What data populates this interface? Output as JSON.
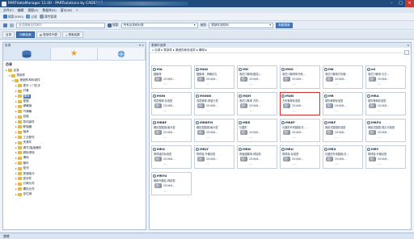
{
  "window": {
    "title": "PARTdataManager 11.00 - PARTsolutions by CADENAS",
    "min": "–",
    "max": "□",
    "close": "×"
  },
  "menu": [
    "文件(F)",
    "编辑",
    "视图(V)",
    "数据库(D)",
    "窗口(W)",
    "?"
  ],
  "toolbar1": {
    "items": [
      {
        "icon": "search-icon",
        "label": "搜索(SMO)",
        "color": "#3f74b7"
      },
      {
        "icon": "filter-icon",
        "label": "过滤",
        "color": "#6b8fc2"
      },
      {
        "icon": "properties-icon",
        "label": "属性管理",
        "color": "#7c98bd"
      }
    ]
  },
  "toolbar2": {
    "search_placeholder": "全文搜索文件夹中",
    "search_button": "搜索",
    "scope_value": "所有目录和分类",
    "mode_value": "按照",
    "unit_value": "零部件或机构",
    "accent_button": "新建搜索"
  },
  "tabs": [
    {
      "label": "目录",
      "active": false
    },
    {
      "label": "对照检索",
      "active": true
    },
    {
      "label": "零部件列表",
      "active": false
    },
    {
      "label": "搜索结果",
      "active": false
    }
  ],
  "left_panel": {
    "header": "目录",
    "tree_title": "目录",
    "tree": [
      {
        "indent": 0,
        "toggle": "▸",
        "label": "目录",
        "color": "#e2b84a",
        "selected": false
      },
      {
        "indent": 1,
        "toggle": "▾",
        "label": "零部件",
        "color": "#e2b84a",
        "selected": false
      },
      {
        "indent": 2,
        "toggle": "▾",
        "label": "紧固件和标准件",
        "color": "#e2b84a",
        "selected": false
      },
      {
        "indent": 3,
        "toggle": "▸",
        "label": "把手 / 门拉手",
        "color": "#e2b84a",
        "selected": false
      },
      {
        "indent": 3,
        "toggle": "▸",
        "label": "衬套",
        "color": "#e2b84a",
        "selected": false
      },
      {
        "indent": 3,
        "toggle": "▸",
        "label": "螺母",
        "color": "#e2b84a",
        "selected": true
      },
      {
        "indent": 3,
        "toggle": "▸",
        "label": "垫圈",
        "color": "#e2b84a",
        "selected": false
      },
      {
        "indent": 3,
        "toggle": "▸",
        "label": "弹簧销",
        "color": "#e2b84a",
        "selected": false
      },
      {
        "indent": 3,
        "toggle": "▸",
        "label": "气弹簧",
        "color": "#e2b84a",
        "selected": false
      },
      {
        "indent": 3,
        "toggle": "▸",
        "label": "铰链",
        "color": "#e2b84a",
        "selected": false
      },
      {
        "indent": 3,
        "toggle": "▸",
        "label": "导向部件",
        "color": "#e2b84a",
        "selected": false
      },
      {
        "indent": 3,
        "toggle": "▸",
        "label": "联轴器",
        "color": "#e2b84a",
        "selected": false
      },
      {
        "indent": 3,
        "toggle": "▸",
        "label": "轴承",
        "color": "#e2b84a",
        "selected": false
      },
      {
        "indent": 3,
        "toggle": "▸",
        "label": "工业配件",
        "color": "#e2b84a",
        "selected": false
      },
      {
        "indent": 3,
        "toggle": "▸",
        "label": "夹紧件",
        "color": "#e2b84a",
        "selected": false
      },
      {
        "indent": 3,
        "toggle": "▸",
        "label": "调节/高度器件",
        "color": "#e2b84a",
        "selected": false
      },
      {
        "indent": 3,
        "toggle": "▸",
        "label": "脚轮滚轮",
        "color": "#e2b84a",
        "selected": false
      },
      {
        "indent": 3,
        "toggle": "▸",
        "label": "滑轨",
        "color": "#e2b84a",
        "selected": false
      },
      {
        "indent": 3,
        "toggle": "▸",
        "label": "管件",
        "color": "#e2b84a",
        "selected": false
      },
      {
        "indent": 3,
        "toggle": "▸",
        "label": "型材",
        "color": "#e2b84a",
        "selected": false
      },
      {
        "indent": 3,
        "toggle": "▸",
        "label": "快速接头",
        "color": "#e2b84a",
        "selected": false
      },
      {
        "indent": 3,
        "toggle": "▸",
        "label": "密封件",
        "color": "#e2b84a",
        "selected": false
      },
      {
        "indent": 3,
        "toggle": "▸",
        "label": "分离元件",
        "color": "#e2b84a",
        "selected": false
      },
      {
        "indent": 3,
        "toggle": "▸",
        "label": "螺纹元件",
        "color": "#e2b84a",
        "selected": false
      },
      {
        "indent": 3,
        "toggle": "▸",
        "label": "定位销",
        "color": "#e2b84a",
        "selected": false
      }
    ]
  },
  "right_panel": {
    "header": "零部件选择",
    "breadcrumb": [
      "目录",
      "零部件",
      "紧固件和标准件",
      "螺母"
    ],
    "cards": [
      {
        "code": "MA",
        "desc": "圆螺母",
        "date": "2016/6...",
        "foot": "----",
        "highlight": false
      },
      {
        "code": "MAN",
        "desc": "圆螺母，带螺纹孔",
        "date": "2016/6...",
        "foot": "----",
        "highlight": false
      },
      {
        "code": "MH",
        "desc": "滚花口螺母(圆柱)...",
        "date": "2016/6...",
        "foot": "----",
        "highlight": false
      },
      {
        "code": "MHS",
        "desc": "滚花口螺母带开槽...",
        "date": "2016/6...",
        "foot": "----",
        "highlight": false
      },
      {
        "code": "MK",
        "desc": "滚花口螺母方形螺...",
        "date": "2016/6...",
        "foot": "----",
        "highlight": false
      },
      {
        "code": "ml",
        "desc": "滚花口螺母 长方...",
        "date": "2016/6...",
        "foot": "----",
        "highlight": false
      },
      {
        "code": "MON",
        "desc": "双层螺母-标准型",
        "date": "2016/6...",
        "foot": "----",
        "highlight": false
      },
      {
        "code": "MONW",
        "desc": "双层螺母-带垫片型",
        "date": "2016/6...",
        "foot": "----",
        "highlight": false
      },
      {
        "code": "MQH",
        "desc": "滚花口螺母 方形...",
        "date": "2016/6...",
        "foot": "----",
        "highlight": false
      },
      {
        "code": "MQN",
        "desc": "方形螺母标准型",
        "date": "2016/6...",
        "foot": "----",
        "highlight": true
      },
      {
        "code": "MR",
        "desc": "锥形螺母标准型",
        "date": "2016/6...",
        "foot": "----",
        "highlight": false
      },
      {
        "code": "MRA",
        "desc": "锥形螺母标准型",
        "date": "2016/6...",
        "foot": "----",
        "highlight": false
      },
      {
        "code": "MRBF",
        "desc": "螺纹型圆锥/面头型",
        "date": "2016/6...",
        "foot": "----",
        "highlight": false
      },
      {
        "code": "MRBFM",
        "desc": "螺纹型圆锥/面头型",
        "date": "2016/6...",
        "foot": "----",
        "highlight": false
      },
      {
        "code": "MRE",
        "desc": "长圆形",
        "date": "2016/6...",
        "foot": "----",
        "highlight": false
      },
      {
        "code": "MREF",
        "desc": "长圆形外壳圆锥/长...",
        "date": "2016/6...",
        "foot": "----",
        "highlight": false
      },
      {
        "code": "MRF",
        "desc": "弹簧式圆锥标准型",
        "date": "2016/6...",
        "foot": "----",
        "highlight": false
      },
      {
        "code": "MRFU",
        "desc": "弹簧式圆锥-锥尖平面型",
        "date": "2016/6...",
        "foot": "----",
        "highlight": false
      },
      {
        "code": "MRG",
        "desc": "带焊接的标准型",
        "date": "2016/6...",
        "foot": "----",
        "highlight": false
      },
      {
        "code": "MRJY",
        "desc": "带焊接 外螺纹型",
        "date": "2016/6...",
        "foot": "----",
        "highlight": false
      },
      {
        "code": "MRN",
        "desc": "带面圆螺母-焊接型",
        "date": "2016/6...",
        "foot": "----",
        "highlight": false
      },
      {
        "code": "MRU",
        "desc": "带焊接-标准型",
        "date": "2016/6...",
        "foot": "----",
        "highlight": false
      },
      {
        "code": "MRX",
        "desc": "长圆形外壳圆锥/长...",
        "date": "2016/6...",
        "foot": "----",
        "highlight": false
      },
      {
        "code": "MRY",
        "desc": "带焊接 外螺纹型",
        "date": "2016/6...",
        "foot": "----",
        "highlight": false
      },
      {
        "code": "MRYU",
        "desc": "螺母外螺纹-焊接型",
        "date": "2016/6...",
        "foot": "----",
        "highlight": false
      }
    ]
  },
  "status": {
    "text": "就绪"
  },
  "colors": {
    "accent": "#3f74b7",
    "titlebar": "#1f4c7d",
    "highlight": "#d0302b"
  }
}
